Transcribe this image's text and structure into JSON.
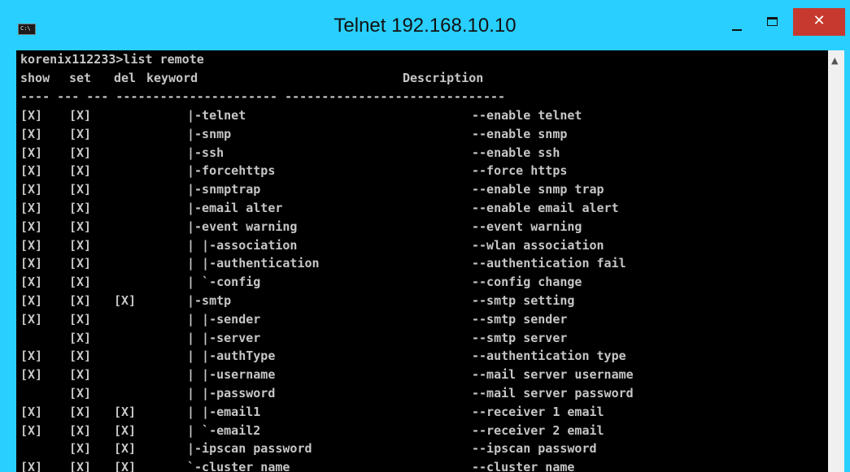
{
  "window": {
    "title": "Telnet 192.168.10.10",
    "icon_label": "C:\\",
    "close_glyph": "✕",
    "up_glyph": "▲"
  },
  "console": {
    "prompt_line": "korenix112233>list remote",
    "header": {
      "show": "show",
      "set": "set",
      "del": "del",
      "keyword": "keyword",
      "description": "Description"
    },
    "separator": "---- --- --- ---------------------- ------------------------------",
    "rows": [
      {
        "show": "[X]",
        "set": "[X]",
        "del": "",
        "keyword": "|-telnet",
        "description": "--enable telnet"
      },
      {
        "show": "[X]",
        "set": "[X]",
        "del": "",
        "keyword": "|-snmp",
        "description": "--enable snmp"
      },
      {
        "show": "[X]",
        "set": "[X]",
        "del": "",
        "keyword": "|-ssh",
        "description": "--enable ssh"
      },
      {
        "show": "[X]",
        "set": "[X]",
        "del": "",
        "keyword": "|-forcehttps",
        "description": "--force https"
      },
      {
        "show": "[X]",
        "set": "[X]",
        "del": "",
        "keyword": "|-snmptrap",
        "description": "--enable snmp trap"
      },
      {
        "show": "[X]",
        "set": "[X]",
        "del": "",
        "keyword": "|-email alter",
        "description": "--enable email alert"
      },
      {
        "show": "[X]",
        "set": "[X]",
        "del": "",
        "keyword": "|-event warning",
        "description": "--event warning"
      },
      {
        "show": "[X]",
        "set": "[X]",
        "del": "",
        "keyword": "| |-association",
        "description": "--wlan association"
      },
      {
        "show": "[X]",
        "set": "[X]",
        "del": "",
        "keyword": "| |-authentication",
        "description": "--authentication fail"
      },
      {
        "show": "[X]",
        "set": "[X]",
        "del": "",
        "keyword": "| `-config",
        "description": "--config change"
      },
      {
        "show": "[X]",
        "set": "[X]",
        "del": "[X]",
        "keyword": "|-smtp",
        "description": "--smtp setting"
      },
      {
        "show": "[X]",
        "set": "[X]",
        "del": "",
        "keyword": "| |-sender",
        "description": "--smtp sender"
      },
      {
        "show": "",
        "set": "[X]",
        "del": "",
        "keyword": "| |-server",
        "description": "--smtp server"
      },
      {
        "show": "[X]",
        "set": "[X]",
        "del": "",
        "keyword": "| |-authType",
        "description": "--authentication type"
      },
      {
        "show": "[X]",
        "set": "[X]",
        "del": "",
        "keyword": "| |-username",
        "description": "--mail server username"
      },
      {
        "show": "",
        "set": "[X]",
        "del": "",
        "keyword": "| |-password",
        "description": "--mail server password"
      },
      {
        "show": "[X]",
        "set": "[X]",
        "del": "[X]",
        "keyword": "| |-email1",
        "description": "--receiver 1 email"
      },
      {
        "show": "[X]",
        "set": "[X]",
        "del": "[X]",
        "keyword": "| `-email2",
        "description": "--receiver 2 email"
      },
      {
        "show": "",
        "set": "[X]",
        "del": "[X]",
        "keyword": "|-ipscan password",
        "description": "--ipscan password"
      },
      {
        "show": "[X]",
        "set": "[X]",
        "del": "[X]",
        "keyword": "`-cluster name",
        "description": "--cluster name"
      }
    ]
  },
  "colors": {
    "titlebar": "#29cfff",
    "console_bg": "#000000",
    "console_text": "#c6c6c6",
    "close_button": "#c7392e"
  }
}
